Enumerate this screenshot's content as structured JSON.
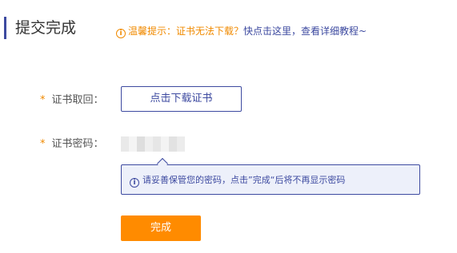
{
  "header": {
    "title": "提交完成",
    "tip_icon": "info-icon",
    "tip_warning": "温馨提示：证书无法下载？",
    "tip_link": "快点击这里，查看详细教程~"
  },
  "form": {
    "retrieve_label": "证书取回：",
    "retrieve_required_mark": "*",
    "download_button": "点击下载证书",
    "password_label": "证书密码：",
    "password_required_mark": "*",
    "password_blurred_shades": [
      "#e9e9e9",
      "#f4f4f4",
      "#dedede",
      "#efefef",
      "#e6e6e6",
      "#f3f3f3",
      "#e2e2e2",
      "#ececec"
    ],
    "note_icon": "info-icon",
    "note_text": "请妥善保管您的密码，点击”完成“后将不再显示密码",
    "done_button": "完成"
  },
  "colors": {
    "primary": "#3d4aa0",
    "accent": "#ff8b00",
    "note_bg": "#edf0fa"
  }
}
